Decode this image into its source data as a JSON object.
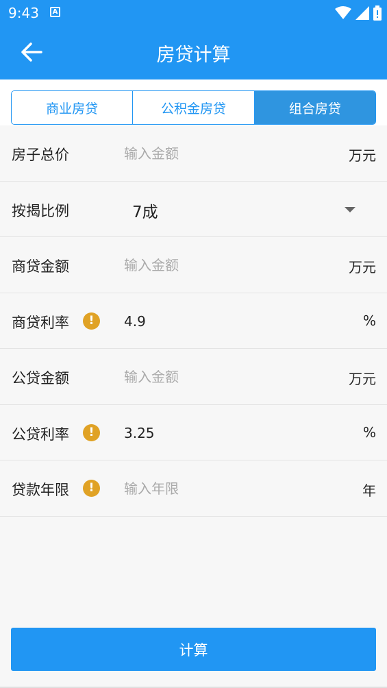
{
  "status_bar": {
    "time": "9:43",
    "icons": [
      "notification-a-icon",
      "wifi-icon",
      "signal-icon",
      "battery-icon"
    ]
  },
  "app_bar": {
    "title": "房贷计算",
    "back_icon": "back-arrow-icon"
  },
  "tabs": [
    {
      "label": "商业房贷",
      "active": false
    },
    {
      "label": "公积金房贷",
      "active": false
    },
    {
      "label": "组合房贷",
      "active": true
    }
  ],
  "form": {
    "total_price": {
      "label": "房子总价",
      "value": "",
      "placeholder": "输入金额",
      "unit": "万元"
    },
    "down_payment": {
      "label": "按揭比例",
      "selected": "7成"
    },
    "commercial_amount": {
      "label": "商贷金额",
      "value": "",
      "placeholder": "输入金额",
      "unit": "万元"
    },
    "commercial_rate": {
      "label": "商贷利率",
      "value": "4.9",
      "placeholder": "",
      "unit": "%"
    },
    "fund_amount": {
      "label": "公贷金额",
      "value": "",
      "placeholder": "输入金额",
      "unit": "万元"
    },
    "fund_rate": {
      "label": "公贷利率",
      "value": "3.25",
      "placeholder": "",
      "unit": "%"
    },
    "loan_term": {
      "label": "贷款年限",
      "value": "",
      "placeholder": "输入年限",
      "unit": "年"
    },
    "warning_glyph": "!"
  },
  "calculate_button": {
    "label": "计算"
  },
  "colors": {
    "primary": "#2196f3",
    "active_tab": "#2f95e0",
    "warning": "#e0a225",
    "background": "#f7f7f7"
  }
}
